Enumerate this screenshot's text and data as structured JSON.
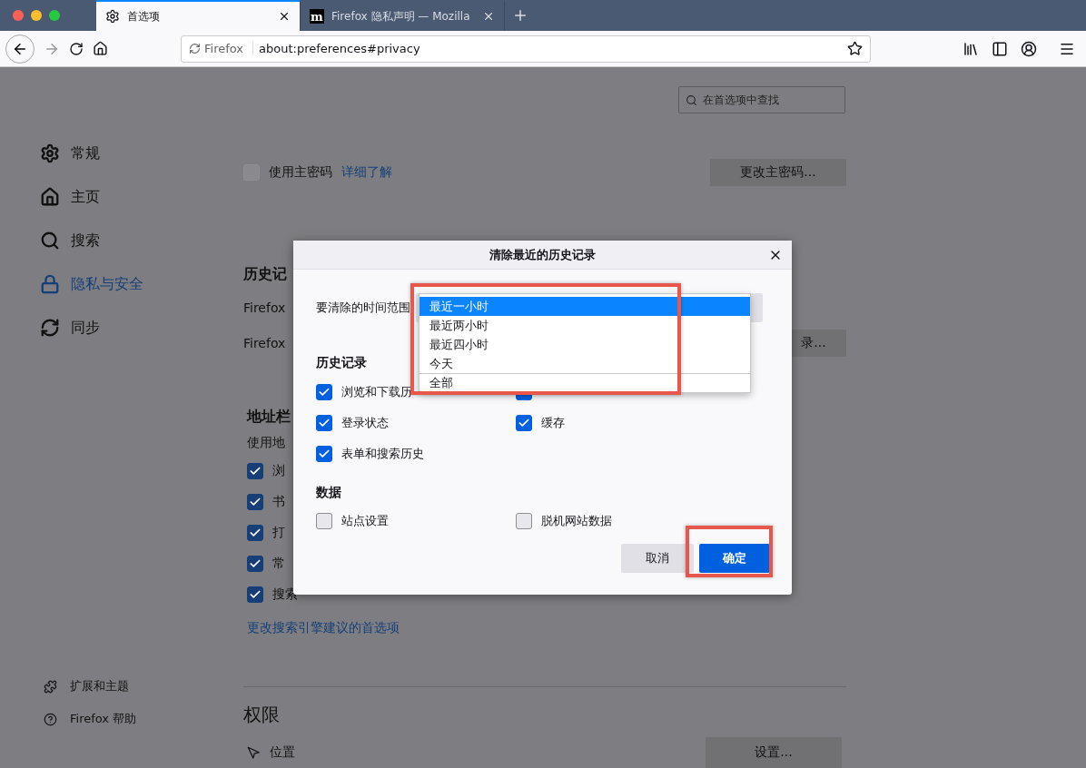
{
  "tabs": [
    {
      "label": "首选项",
      "selected": true
    },
    {
      "label": "Firefox 隐私声明 — Mozilla",
      "logo_text": "m",
      "selected": false
    }
  ],
  "address_bar": {
    "identity": "Firefox",
    "url": "about:preferences#privacy"
  },
  "search": {
    "placeholder": "在首选项中查找"
  },
  "sidebar": {
    "items": [
      {
        "label": "常规",
        "selected": false
      },
      {
        "label": "主页",
        "selected": false
      },
      {
        "label": "搜索",
        "selected": false
      },
      {
        "label": "隐私与安全",
        "selected": true
      },
      {
        "label": "同步",
        "selected": false
      }
    ],
    "footer": [
      "扩展和主题",
      "Firefox 帮助"
    ]
  },
  "content": {
    "master_password": {
      "label": "使用主密码",
      "checked": false,
      "link": "详细了解",
      "button": "更改主密码..."
    },
    "history": {
      "heading": "历史记",
      "lines": [
        "Firefox",
        "Firefox"
      ],
      "button": "录..."
    },
    "address_bar": {
      "heading": "地址栏",
      "intro": "使用地",
      "options": [
        {
          "label": "浏",
          "checked": true
        },
        {
          "label": "书",
          "checked": true
        },
        {
          "label": "打",
          "checked": true
        },
        {
          "label": "常",
          "checked": true
        },
        {
          "label": "搜索",
          "checked": true
        }
      ],
      "link": "更改搜索引擎建议的首选项"
    },
    "permissions": {
      "heading": "权限",
      "items": [
        {
          "label": "位置",
          "button": "设置..."
        }
      ]
    }
  },
  "dialog": {
    "title": "清除最近的历史记录",
    "range_label": "要清除的时间范围",
    "range_list": {
      "highlighted": true,
      "options": [
        {
          "label": "最近一小时",
          "selected": true
        },
        {
          "label": "最近两小时",
          "selected": false
        },
        {
          "label": "最近四小时",
          "selected": false
        },
        {
          "label": "今天",
          "selected": false
        },
        {
          "label": "全部",
          "selected": false
        }
      ]
    },
    "sections": [
      {
        "heading": "历史记录",
        "items": [
          {
            "label": "浏览和下载历",
            "checked": true
          },
          {
            "checked": true
          },
          {
            "label": "登录状态",
            "checked": true
          },
          {
            "label": "缓存",
            "checked": true
          },
          {
            "label": "表单和搜索历史",
            "checked": true
          }
        ]
      },
      {
        "heading": "数据",
        "items": [
          {
            "label": "站点设置",
            "checked": false
          },
          {
            "label": "脱机网站数据",
            "checked": false
          }
        ]
      }
    ],
    "buttons": [
      {
        "label": "取消",
        "kind": "secondary",
        "highlighted": false
      },
      {
        "label": "确定",
        "kind": "primary",
        "highlighted": true
      }
    ]
  }
}
